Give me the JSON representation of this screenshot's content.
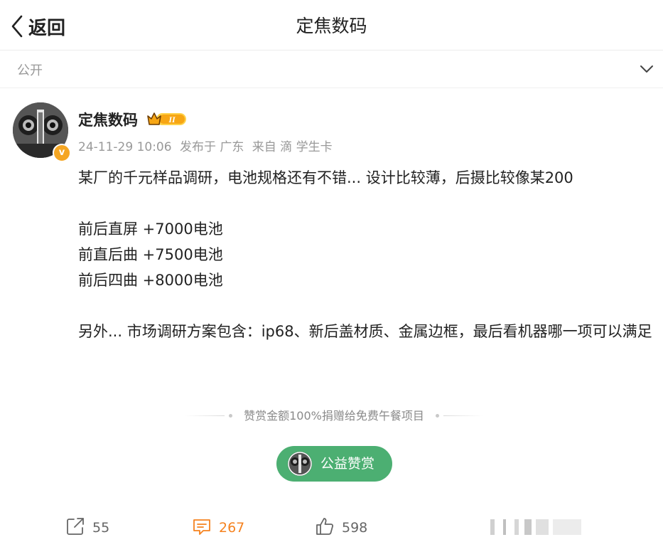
{
  "header": {
    "back_label": "返回",
    "title": "定焦数码"
  },
  "visibility": {
    "label": "公开"
  },
  "post": {
    "author": "定焦数码",
    "avatar_badge": "v",
    "vip_badge_text": "II",
    "meta": {
      "time": "24-11-29 10:06",
      "location": "发布于 广东",
      "source": "来自 滴 学生卡"
    },
    "paragraphs": [
      "某厂的千元样品调研，电池规格还有不错... 设计比较薄，后摄比较像某200",
      "",
      "前后直屏 +7000电池",
      "前直后曲 +7500电池",
      "前后四曲 +8000电池",
      "",
      "另外... 市场调研方案包含：ip68、新后盖材质、金属边框，最后看机器哪一项可以满足"
    ]
  },
  "reward": {
    "note": "赞赏金额100%捐赠给免费午餐项目",
    "button_label": "公益赞赏"
  },
  "actions": {
    "repost_count": "55",
    "comment_count": "267",
    "like_count": "598"
  },
  "colors": {
    "accent_orange": "#f5821f",
    "reward_green": "#4caf72",
    "badge_gold": "#f5a623"
  }
}
